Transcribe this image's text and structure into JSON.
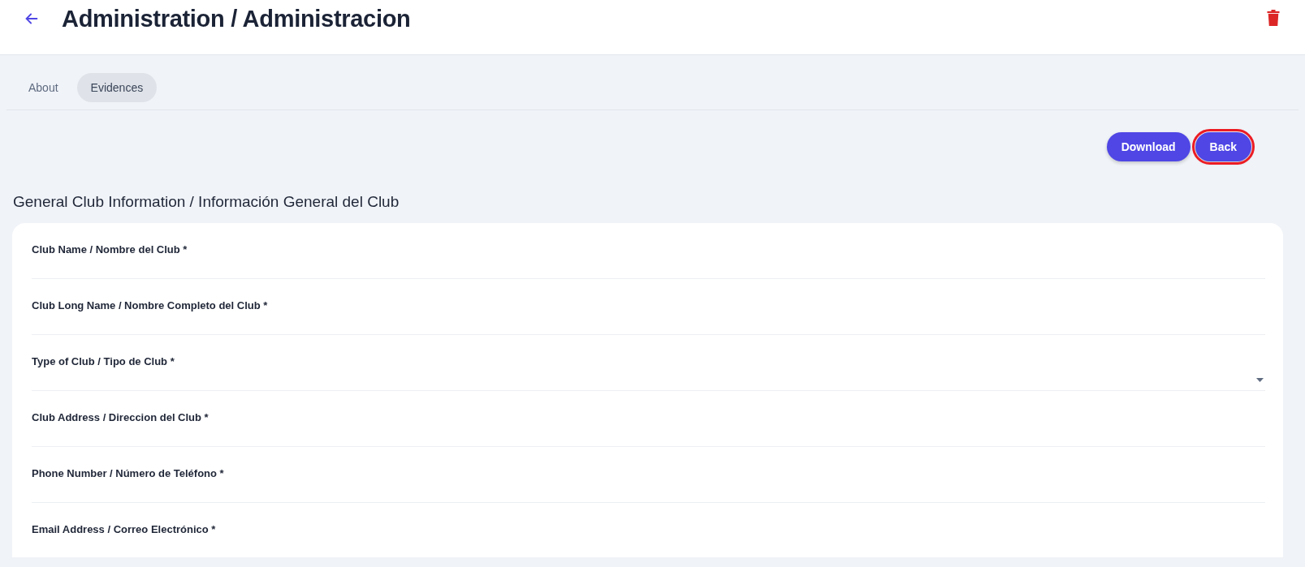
{
  "header": {
    "title": "Administration / Administracion"
  },
  "tabs": [
    {
      "label": "About",
      "selected": false
    },
    {
      "label": "Evidences",
      "selected": true
    }
  ],
  "actions": [
    {
      "label": "Download",
      "highlighted": false
    },
    {
      "label": "Back",
      "highlighted": true
    }
  ],
  "section": {
    "title": "General Club Information / Información General del Club"
  },
  "fields": [
    {
      "label": "Club Name / Nombre del Club *",
      "kind": "text"
    },
    {
      "label": "Club Long Name / Nombre Completo del Club *",
      "kind": "text"
    },
    {
      "label": "Type of Club / Tipo de Club *",
      "kind": "select"
    },
    {
      "label": "Club Address / Direccion del Club *",
      "kind": "text"
    },
    {
      "label": "Phone Number / Número de Teléfono *",
      "kind": "text"
    },
    {
      "label": "Email Address / Correo Electrónico *",
      "kind": "text"
    }
  ]
}
